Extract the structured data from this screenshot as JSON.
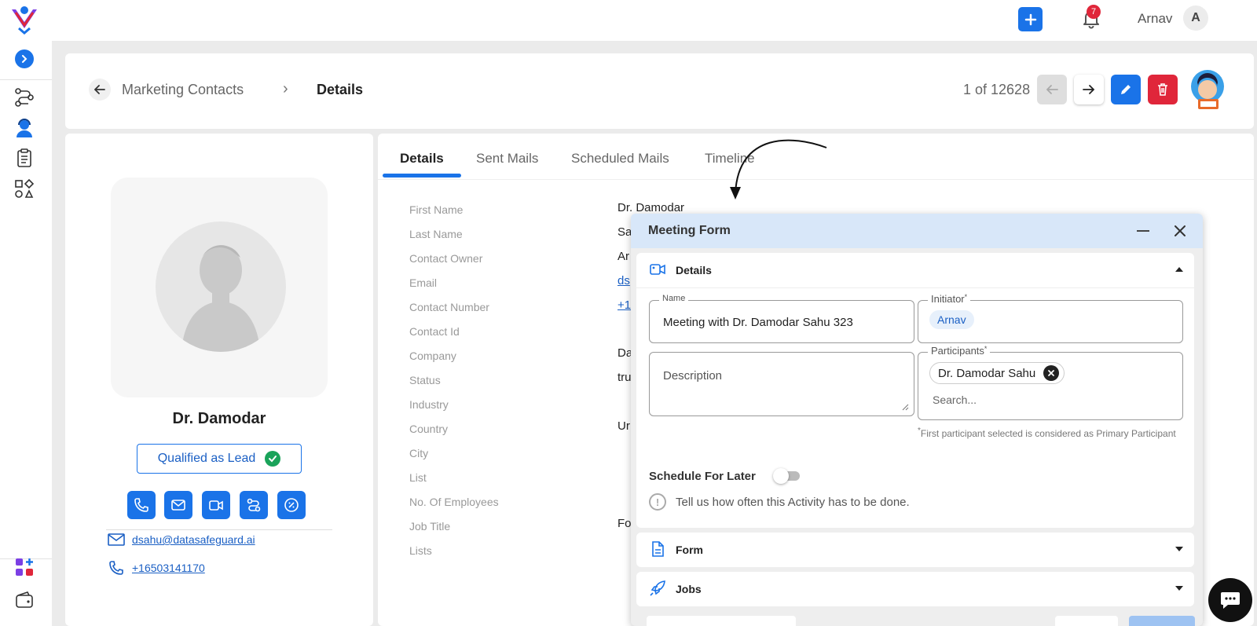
{
  "colors": {
    "accent": "#1a73e8",
    "danger": "#e0263a",
    "success": "#1aa35a",
    "modal_header": "#d8e7f9"
  },
  "topbar": {
    "add_icon": "plus-icon",
    "notification_icon": "bell-icon",
    "notification_count": "7",
    "user_name": "Arnav",
    "user_initial": "A"
  },
  "leftnav": {
    "items": [
      "chevron-right-icon",
      "workflow-icon",
      "contacts-icon",
      "clipboard-icon",
      "shapes-icon",
      "apps-add-icon",
      "wallet-icon"
    ]
  },
  "header": {
    "breadcrumb_parent": "Marketing Contacts",
    "breadcrumb_separator": "›",
    "breadcrumb_current": "Details",
    "pager_text": "1 of 12628"
  },
  "profile": {
    "name": "Dr. Damodar",
    "status_badge": "Qualified as Lead",
    "actions": [
      "phone-icon",
      "mail-icon",
      "video-icon",
      "route-icon",
      "discount-icon"
    ],
    "email": "dsahu@datasafeguard.ai",
    "phone": "+16503141170"
  },
  "tabs": [
    "Details",
    "Sent Mails",
    "Scheduled Mails",
    "Timeline"
  ],
  "fields": {
    "labels": [
      "First Name",
      "Last Name",
      "Contact Owner",
      "Email",
      "Contact Number",
      "Contact Id",
      "Company",
      "Status",
      "Industry",
      "Country",
      "City",
      "List",
      "No. Of Employees",
      "Job Title",
      "Lists"
    ],
    "first_name": "Dr. Damodar",
    "last_name_partial": "Sa",
    "owner_partial": "Ar",
    "email_partial": "ds",
    "number_partial": "+1(",
    "company_partial": "Da",
    "status_partial": "tru",
    "country_partial": "Ur",
    "job_partial": "Fo"
  },
  "meeting_form": {
    "title": "Meeting Form",
    "details_section": "Details",
    "name_label": "Name",
    "name_value": "Meeting with Dr. Damodar Sahu 323",
    "initiator_label": "Initiator",
    "initiator_value": "Arnav",
    "description_placeholder": "Description",
    "participants_label": "Participants",
    "participant_chip": "Dr. Damodar Sahu",
    "search_placeholder": "Search...",
    "participant_hint": "First participant selected is considered as Primary Participant",
    "required_mark": "*",
    "schedule_label": "Schedule For Later",
    "schedule_enabled": false,
    "info_text": "Tell us how often this Activity has to be done.",
    "form_section": "Form",
    "jobs_section": "Jobs"
  },
  "chat_icon": "chat-icon"
}
